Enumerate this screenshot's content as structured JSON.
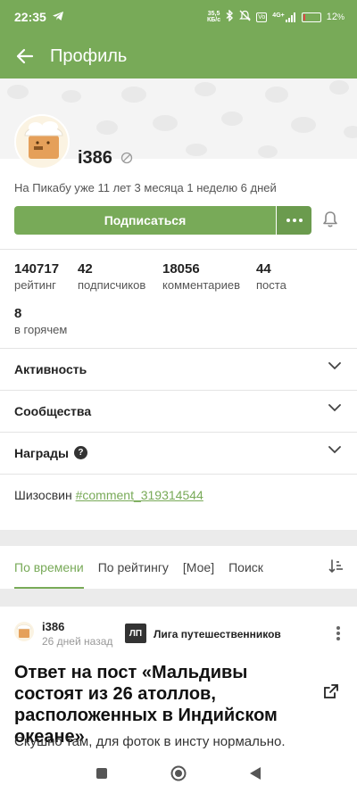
{
  "status_bar": {
    "time": "22:35",
    "net_speed_value": "35,5",
    "net_speed_unit": "КБ/с",
    "vo_badge": "Vo",
    "net_type": "4G+",
    "battery_percent": "12",
    "battery_level": 0.12,
    "battery_color": "#e04a4a"
  },
  "app_bar": {
    "title": "Профиль"
  },
  "profile": {
    "username": "i386",
    "member_since": "На Пикабу уже 11 лет 3 месяца 1 неделю 6 дней",
    "subscribe_label": "Подписаться"
  },
  "stats": [
    {
      "value": "140717",
      "label": "рейтинг"
    },
    {
      "value": "42",
      "label": "подписчиков"
    },
    {
      "value": "18056",
      "label": "комментариев"
    },
    {
      "value": "44",
      "label": "поста"
    },
    {
      "value": "8",
      "label": "в горячем"
    }
  ],
  "sections": [
    {
      "label": "Активность"
    },
    {
      "label": "Сообщества"
    },
    {
      "label": "Награды"
    }
  ],
  "bio": {
    "text": "Шизосвин",
    "link": "#comment_319314544"
  },
  "sort_tabs": [
    {
      "label": "По времени",
      "active": true
    },
    {
      "label": "По рейтингу",
      "active": false
    },
    {
      "label": "[Мое]",
      "active": false
    },
    {
      "label": "Поиск",
      "active": false
    }
  ],
  "post": {
    "author": "i386",
    "time": "26 дней назад",
    "community_icon_text": "ЛП",
    "community": "Лига путешественников",
    "title": "Ответ на пост «Мальдивы состоят из 26 атоллов, расположенных в Индийском океане»",
    "text": "Скушно там, для фоток в инсту нормально."
  },
  "colors": {
    "brand_green": "#78aa58",
    "dark_green": "#6b9b4e"
  }
}
